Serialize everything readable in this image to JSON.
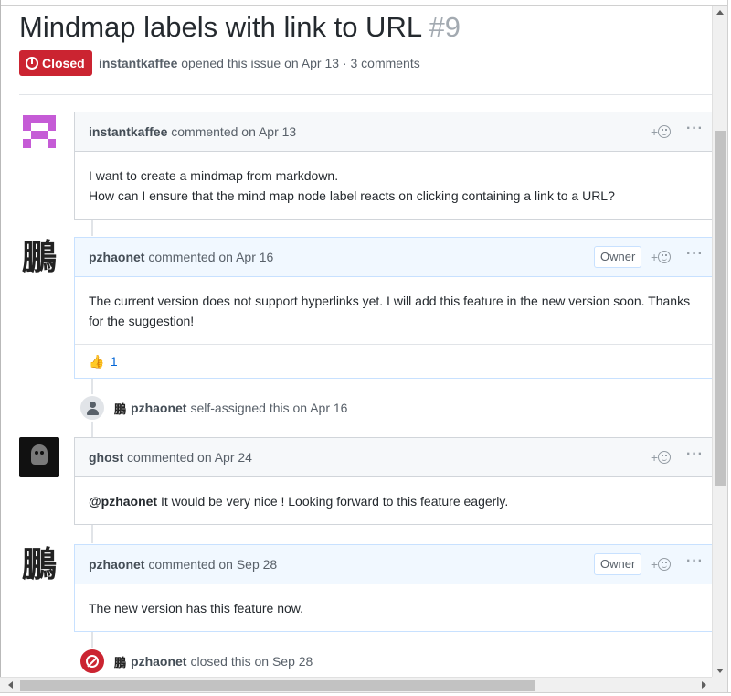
{
  "issue": {
    "title": "Mindmap labels with link to URL",
    "number": "#9",
    "state": "Closed",
    "author": "instantkaffee",
    "opened_text": "opened this issue on Apr 13 · 3 comments"
  },
  "comments": [
    {
      "author": "instantkaffee",
      "action": "commented on Apr 13",
      "owner_badge": "",
      "body_lines": [
        "I want to create a mindmap from markdown.",
        "How can I ensure that the mind map node label reacts on clicking containing a link to a URL?"
      ]
    },
    {
      "author": "pzhaonet",
      "action": "commented on Apr 16",
      "owner_badge": "Owner",
      "avatar_char": "鵬",
      "body_lines": [
        "The current version does not support hyperlinks yet. I will add this feature in the new version soon. Thanks",
        "for the suggestion!"
      ],
      "reaction": {
        "emoji": "👍",
        "count": "1"
      }
    },
    {
      "author": "ghost",
      "action": "commented on Apr 24",
      "owner_badge": "",
      "mention": "@pzhaonet",
      "body_rest": " It would be very nice ! Looking forward to this feature eagerly."
    },
    {
      "author": "pzhaonet",
      "action": "commented on Sep 28",
      "owner_badge": "Owner",
      "avatar_char": "鵬",
      "body_lines": [
        "The new version has this feature now."
      ]
    }
  ],
  "events": [
    {
      "avatar_char": "鵬",
      "actor": "pzhaonet",
      "text": "self-assigned this on Apr 16"
    },
    {
      "avatar_char": "鵬",
      "actor": "pzhaonet",
      "text": "closed this on Sep 28"
    }
  ],
  "reaction_button": {
    "plus": "+"
  },
  "more_button": "···",
  "colors": {
    "closed_red": "#cb2431",
    "link_blue": "#0366d6",
    "owner_border": "#c8e1ff",
    "avatar_purple": "#c55bd6"
  },
  "icons": {
    "state": "issue-closed-icon",
    "assign_event": "person-icon",
    "close_event": "circle-slash-icon",
    "reaction_add": "smiley-icon"
  }
}
